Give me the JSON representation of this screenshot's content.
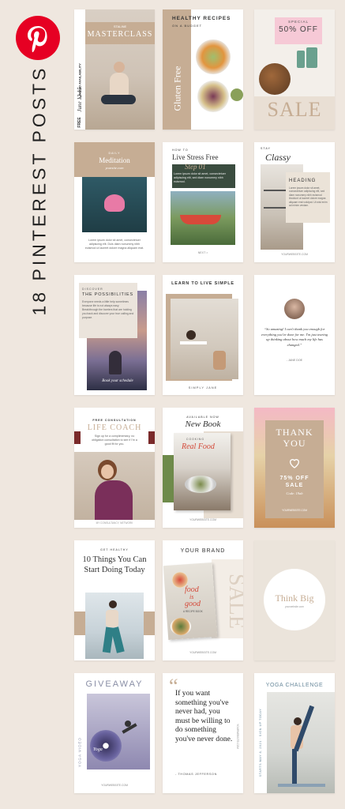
{
  "title": "18 PINTEREST POSTS",
  "colors": {
    "background": "#efe7df",
    "pinterest": "#e60023",
    "tan": "#c6ad94",
    "dark": "#333333"
  },
  "cards": {
    "c1": {
      "top": "STALINE",
      "title": "MASTERCLASS",
      "side": "LIMITED AVAILABILITY",
      "date": "June 12-15",
      "free": "FREE"
    },
    "c2": {
      "title": "HEALTHY RECIPES",
      "sub": "ON A BUDGET",
      "side": "Gluten Free"
    },
    "c3": {
      "top": "SPECIAL",
      "offer": "50% OFF",
      "big": "SALE"
    },
    "c4": {
      "top": "DAILY",
      "title": "Meditation",
      "site": "yoursite.com",
      "body": "Lorem ipsum dolor sit amet, consectetuer adipiscing elit. Duis diam nonummy nibh euismod ut laoreet dolore magna aliquam erat."
    },
    "c5": {
      "top": "HOW TO",
      "title": "Live Stress Free",
      "step": "Step 01",
      "body": "Lorem ipsum dolor sit amet, consectetuer adipiscing elit, sed diam nonummy nibh euismod.",
      "foot": "NEXT >"
    },
    "c6": {
      "top": "STAY",
      "title": "Classy",
      "heading": "HEADING",
      "body": "Lorem ipsum dolor sit amet, consectetuer adipiscing elit, sed diam nonummy nibh euismod tincidunt ut laoreet dolore magna aliquam erat volutpat. Ut wisi enim ad minim veniam.",
      "site": "YOURWEBSITE.COM"
    },
    "c7": {
      "top": "DISCOVER",
      "title": "THE POSSIBILITIES",
      "body": "Everyone needs a little help sometimes because life is not always easy. Breakthrough the barriers that are holding you back and discover your true calling and purpose.",
      "sign": "Book your schedule"
    },
    "c8": {
      "title": "LEARN TO LIVE SIMPLE",
      "foot": "SIMPLY JANE"
    },
    "c9": {
      "quote": "“So amazing! I can't thank you enough for everything you've done for me. I'm just tearing up thinking about how much my life has changed.”",
      "author": "- JANE DOE"
    },
    "c10": {
      "top": "FREE CONSULTATION",
      "title": "LIFE COACH",
      "body": "Sign up for a complimentary, no obligation consultation to see if I'm a good fit for you.",
      "foot": "MY CONSULTANCY, NETWORK"
    },
    "c11": {
      "top": "AVAILABLE NOW",
      "title": "New Book",
      "small": "COOKING",
      "book": "Real Food",
      "site": "YOURWEBSITE.COM"
    },
    "c12": {
      "title": "THANK YOU",
      "icon": "heart-icon",
      "offer": "75% OFF",
      "sale": "SALE",
      "code": "Code: 19ab",
      "site": "YOURWEBSITE.COM"
    },
    "c13": {
      "top": "GET HEALTHY",
      "title": "10 Things You Can Start Doing Today"
    },
    "c14": {
      "title": "YOUR BRAND",
      "book1": "food",
      "book2": "is",
      "book3": "good",
      "book_sub": "A RECIPE BOOK",
      "side": "SALE",
      "site": "YOURWEBSITE.COM"
    },
    "c15": {
      "title": "Think Big",
      "sub": "yourwebsite.com"
    },
    "c16": {
      "title": "GIVEAWAY",
      "side": "YOGA VIDEO",
      "site": "YOURWEBSITE.COM",
      "disc": "Yoga"
    },
    "c17": {
      "quote": "If you want something you've never had, you must be willing to do something you've never done.",
      "author": "- THOMAS JEFFERSON",
      "side": "YOURWEBSITE.COM"
    },
    "c18": {
      "title": "YOGA CHALLENGE",
      "side": "STARTS MAY 8, 2021 · SIGN UP TODAY"
    }
  }
}
